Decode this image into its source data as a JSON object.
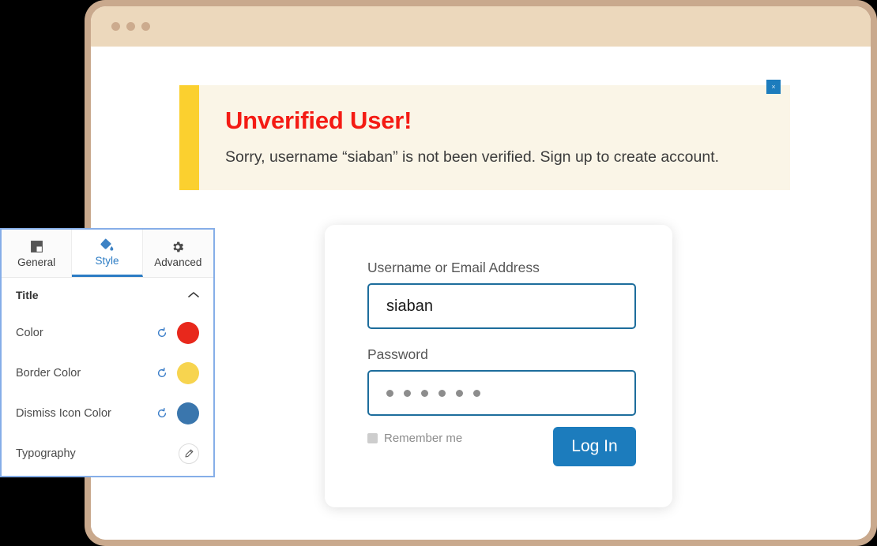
{
  "browser": {
    "titlebar": {
      "dots": [
        "dot-1",
        "dot-2",
        "dot-3"
      ]
    }
  },
  "alert": {
    "title": "Unverified User!",
    "message": "Sorry, username “siaban” is not been verified. Sign up to create account.",
    "dismiss_label": "×",
    "colors": {
      "title": "#f41b14",
      "accent_bar": "#fbd02f",
      "background": "#faf5e7",
      "dismiss_icon": "#1c7cbd"
    }
  },
  "login": {
    "username_label": "Username or Email Address",
    "username_value": "siaban",
    "username_placeholder": "Username or Email Address",
    "password_label": "Password",
    "password_value": "●●●●●●",
    "password_dot_count": 6,
    "remember_me_label": "Remember me",
    "remember_me_checked": false,
    "submit_label": "Log In",
    "submit_color": "#1c7cbd"
  },
  "settings_panel": {
    "tabs": [
      {
        "label": "General",
        "icon": "save-icon",
        "active": false
      },
      {
        "label": "Style",
        "icon": "paint-bucket-icon",
        "active": true
      },
      {
        "label": "Advanced",
        "icon": "gear-icon",
        "active": false
      }
    ],
    "section": {
      "label": "Title",
      "expanded": true,
      "chevron_icon": "chevron-up-icon"
    },
    "controls": [
      {
        "label": "Color",
        "type": "color",
        "value": "#e8281c",
        "reset_icon": "reset-icon"
      },
      {
        "label": "Border Color",
        "type": "color",
        "value": "#f7d44f",
        "reset_icon": "reset-icon"
      },
      {
        "label": "Dismiss Icon Color",
        "type": "color",
        "value": "#3a76ad",
        "reset_icon": "reset-icon"
      },
      {
        "label": "Typography",
        "type": "edit",
        "value": "",
        "edit_icon": "pencil-icon"
      }
    ]
  }
}
